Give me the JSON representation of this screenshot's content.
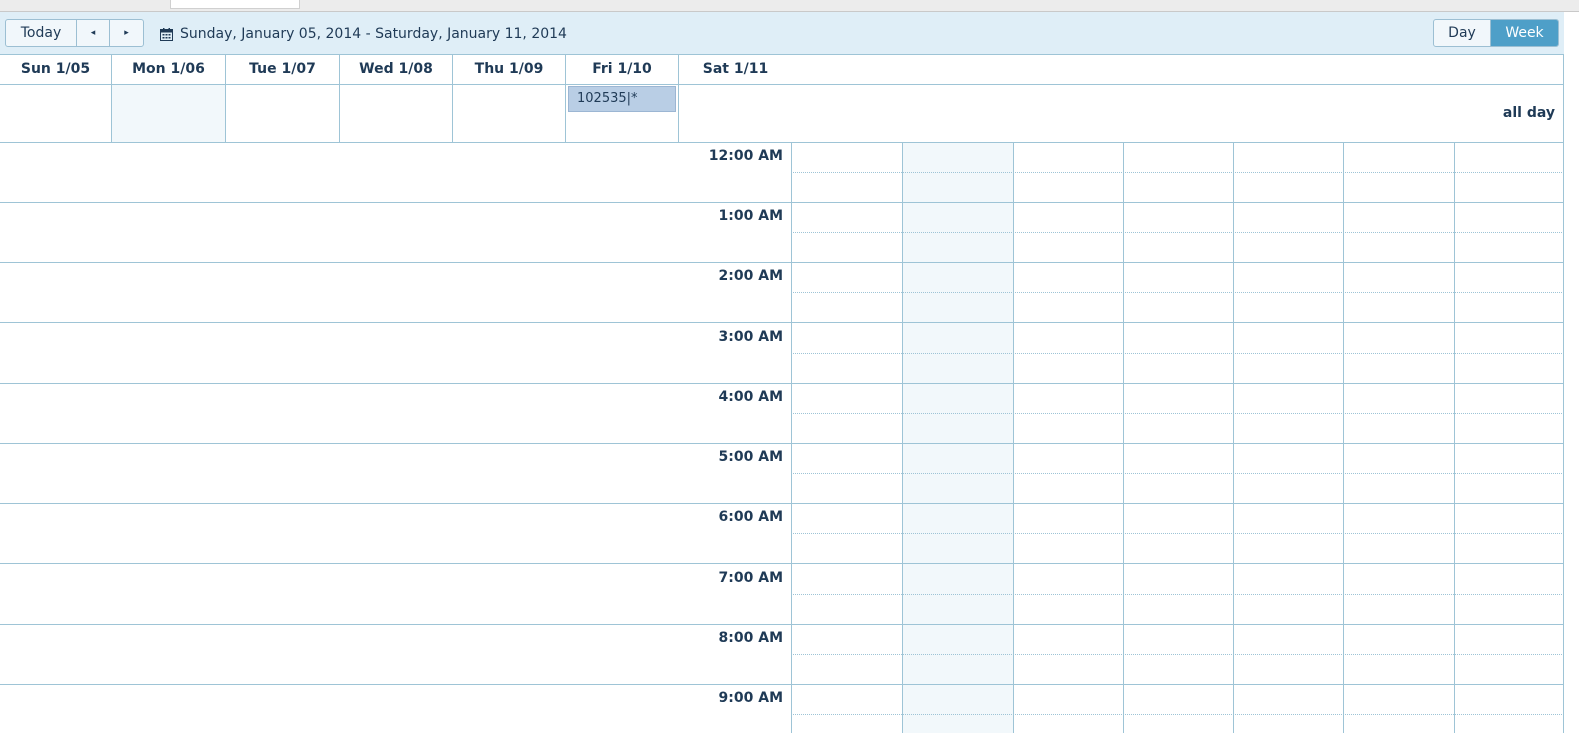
{
  "toolbar": {
    "today_label": "Today",
    "prev_icon": "◂",
    "next_icon": "▸",
    "date_range": "Sunday, January 05, 2014 - Saturday, January 11, 2014",
    "day_label": "Day",
    "week_label": "Week",
    "active_view": "Week",
    "accent_color": "#4e9fc8"
  },
  "week": {
    "days": [
      "Sun 1/05",
      "Mon 1/06",
      "Tue 1/07",
      "Wed 1/08",
      "Thu 1/09",
      "Fri 1/10",
      "Sat 1/11"
    ],
    "allday_label": "all day",
    "events": [
      {
        "title": "102535|*",
        "day": "Fri 1/10",
        "all_day": true
      }
    ]
  },
  "times": [
    "12:00 AM",
    "1:00 AM",
    "2:00 AM",
    "3:00 AM",
    "4:00 AM",
    "5:00 AM",
    "6:00 AM",
    "7:00 AM",
    "8:00 AM",
    "9:00 AM"
  ]
}
